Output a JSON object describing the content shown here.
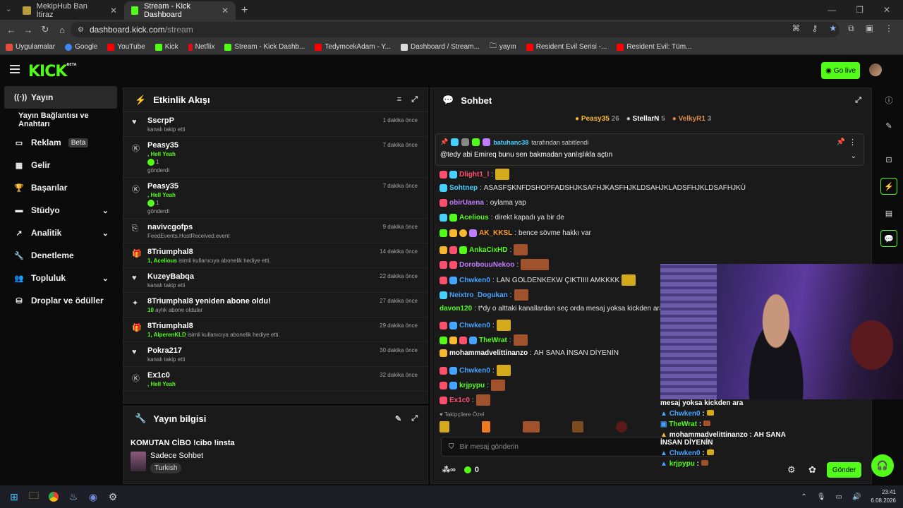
{
  "browser": {
    "tabs": [
      {
        "title": "MekipHub Ban İtiraz",
        "active": false
      },
      {
        "title": "Stream - Kick Dashboard",
        "active": true
      }
    ],
    "url_domain": "dashboard.kick.com",
    "url_path": "/stream",
    "bookmarks": [
      "Uygulamalar",
      "Google",
      "YouTube",
      "Kick",
      "Netflix",
      "Stream - Kick Dashb...",
      "TedymcekAdam - Y...",
      "Dashboard / Stream...",
      "yayın",
      "Resident Evil Serisi -...",
      "Resident Evil: Tüm..."
    ]
  },
  "header": {
    "logo": "KICK",
    "logo_badge": "BETA",
    "go_live": "Go live"
  },
  "sidebar": {
    "items": [
      {
        "label": "Yayın",
        "icon": "broadcast-icon",
        "active": true
      },
      {
        "label": "Yayın Bağlantısı ve Anahtarı",
        "sub": true
      },
      {
        "label": "Reklam",
        "badge": "Beta",
        "icon": "ads-icon"
      },
      {
        "label": "Gelir",
        "icon": "revenue-icon"
      },
      {
        "label": "Başarılar",
        "icon": "trophy-icon"
      },
      {
        "label": "Stüdyo",
        "icon": "studio-icon",
        "chevron": true
      },
      {
        "label": "Analitik",
        "icon": "analytics-icon",
        "chevron": true
      },
      {
        "label": "Denetleme",
        "icon": "wrench-icon"
      },
      {
        "label": "Topluluk",
        "icon": "community-icon",
        "chevron": true
      },
      {
        "label": "Droplar ve ödüller",
        "icon": "drops-icon"
      }
    ]
  },
  "activity": {
    "title": "Etkinlik Akışı",
    "events": [
      {
        "name": "SscrpP",
        "desc": "kanalı takip etti",
        "time": "1 dakika önce",
        "icon": "heart-icon"
      },
      {
        "name": "Peasy35",
        "green": ", Hell Yeah",
        "count": "1",
        "desc": "gönderdi",
        "time": "7 dakika önce",
        "icon": "kick-icon"
      },
      {
        "name": "Peasy35",
        "green": ", Hell Yeah",
        "count": "1",
        "desc": "gönderdi",
        "time": "7 dakika önce",
        "icon": "kick-icon"
      },
      {
        "name": "navivcgofps",
        "desc": "FeedEvents.HostReceived.event",
        "time": "9 dakika önce",
        "icon": "host-icon"
      },
      {
        "name": "8Triumphal8",
        "green": "1, Acelious",
        "desc": "isimli kullanıcıya abonelik hediye etti.",
        "time": "14 dakika önce",
        "icon": "gift-icon"
      },
      {
        "name": "KuzeyBabqa",
        "desc": "kanalı takip etti",
        "time": "22 dakika önce",
        "icon": "heart-icon"
      },
      {
        "name": "8Triumphal8 yeniden abone oldu!",
        "green": "10",
        "desc": "aylık abone oldular",
        "time": "27 dakika önce",
        "icon": "sparkle-icon"
      },
      {
        "name": "8Triumphal8",
        "green": "1, AlperenKLD",
        "desc": "isimli kullanıcıya abonelik hediye etti.",
        "time": "29 dakika önce",
        "icon": "gift-icon"
      },
      {
        "name": "Pokra217",
        "desc": "kanalı takip etti",
        "time": "30 dakika önce",
        "icon": "heart-icon"
      },
      {
        "name": "Ex1c0",
        "green": ", Hell Yeah",
        "desc": "",
        "time": "32 dakika önce",
        "icon": "kick-icon"
      }
    ]
  },
  "stream_info": {
    "title": "Yayın bilgisi",
    "stream_title": "KOMUTAN CİBO !cibo !insta",
    "category": "Sadece Sohbet",
    "language": "Turkish"
  },
  "chat": {
    "title": "Sohbet",
    "leaders": [
      {
        "name": "Peasy35",
        "value": "26"
      },
      {
        "name": "StellarN",
        "value": "5"
      },
      {
        "name": "VelkyR1",
        "value": "3"
      }
    ],
    "pinned_by": "batuhanc38",
    "pinned_suffix": "tarafından sabitlendi",
    "pinned_text": "@tedy abi Emireq bunu sen bakmadan yanlışlıkla açtın",
    "messages": [
      {
        "user": "Dlight1_l",
        "color": "#ff4f6d",
        "text": ""
      },
      {
        "user": "Sohtnep",
        "color": "#45d0ff",
        "text": "ASASFŞKNFDSHOPFADSHJKSAFHJKASFHJKLDSAHJKLADSFHJKLDSAFHJKÜ"
      },
      {
        "user": "obirUaena",
        "color": "#c07cff",
        "text": "oylama yap"
      },
      {
        "user": "Acelious",
        "color": "#53fc18",
        "text": "direkt kapadı ya bir de"
      },
      {
        "user": "AK_KKSL",
        "color": "#ff9d2e",
        "text": "bence sövme hakkı var"
      },
      {
        "user": "AnkaCixHD",
        "color": "#53fc18",
        "text": ""
      },
      {
        "user": "DorobouuNekoo",
        "color": "#c07cff",
        "text": ""
      },
      {
        "user": "Chwken0",
        "color": "#45a4ff",
        "text": "LAN GOLDENKEKW ÇIKTIIII AMKKKK"
      },
      {
        "user": "Neixtro_Dogukan",
        "color": "#45a4ff",
        "text": ""
      },
      {
        "user": "davon120",
        "color": "#53fc18",
        "text": "t*dy o alttaki kanallardan seç orda mesaj yoksa kickden ara"
      },
      {
        "user": "Chwken0",
        "color": "#45a4ff",
        "text": ""
      },
      {
        "user": "TheWrat",
        "color": "#53fc18",
        "text": ""
      },
      {
        "user": "mohammadvelittinanzo",
        "color": "#ffffff",
        "text": "AH SANA İNSAN DİYENİN"
      },
      {
        "user": "Chwken0",
        "color": "#45a4ff",
        "text": ""
      },
      {
        "user": "krjpypu",
        "color": "#53fc18",
        "text": ""
      },
      {
        "user": "Ex1c0",
        "color": "#ff4f6d",
        "text": ""
      }
    ],
    "followers_only": "Takipçilere Özel",
    "input_placeholder": "Bir mesaj gönderin",
    "viewers": "0",
    "send_label": "Gönder"
  },
  "overlay": {
    "lines": [
      {
        "user": "",
        "text": "mesaj yoksa kickden ara"
      },
      {
        "user": "Chwken0",
        "text": ":"
      },
      {
        "user": "TheWrat",
        "text": ":"
      },
      {
        "user": "mohammadvelittinanzo",
        "text": ": AH SANA İNSAN DİYENİN"
      },
      {
        "user": "Chwken0",
        "text": ":"
      },
      {
        "user": "krjpypu",
        "text": ":"
      }
    ]
  },
  "taskbar": {
    "time": "23:41",
    "date": "6.08.2026"
  },
  "colors": {
    "accent": "#53fc18",
    "background": "#0b0b0c",
    "panel": "#1a1a1b"
  }
}
